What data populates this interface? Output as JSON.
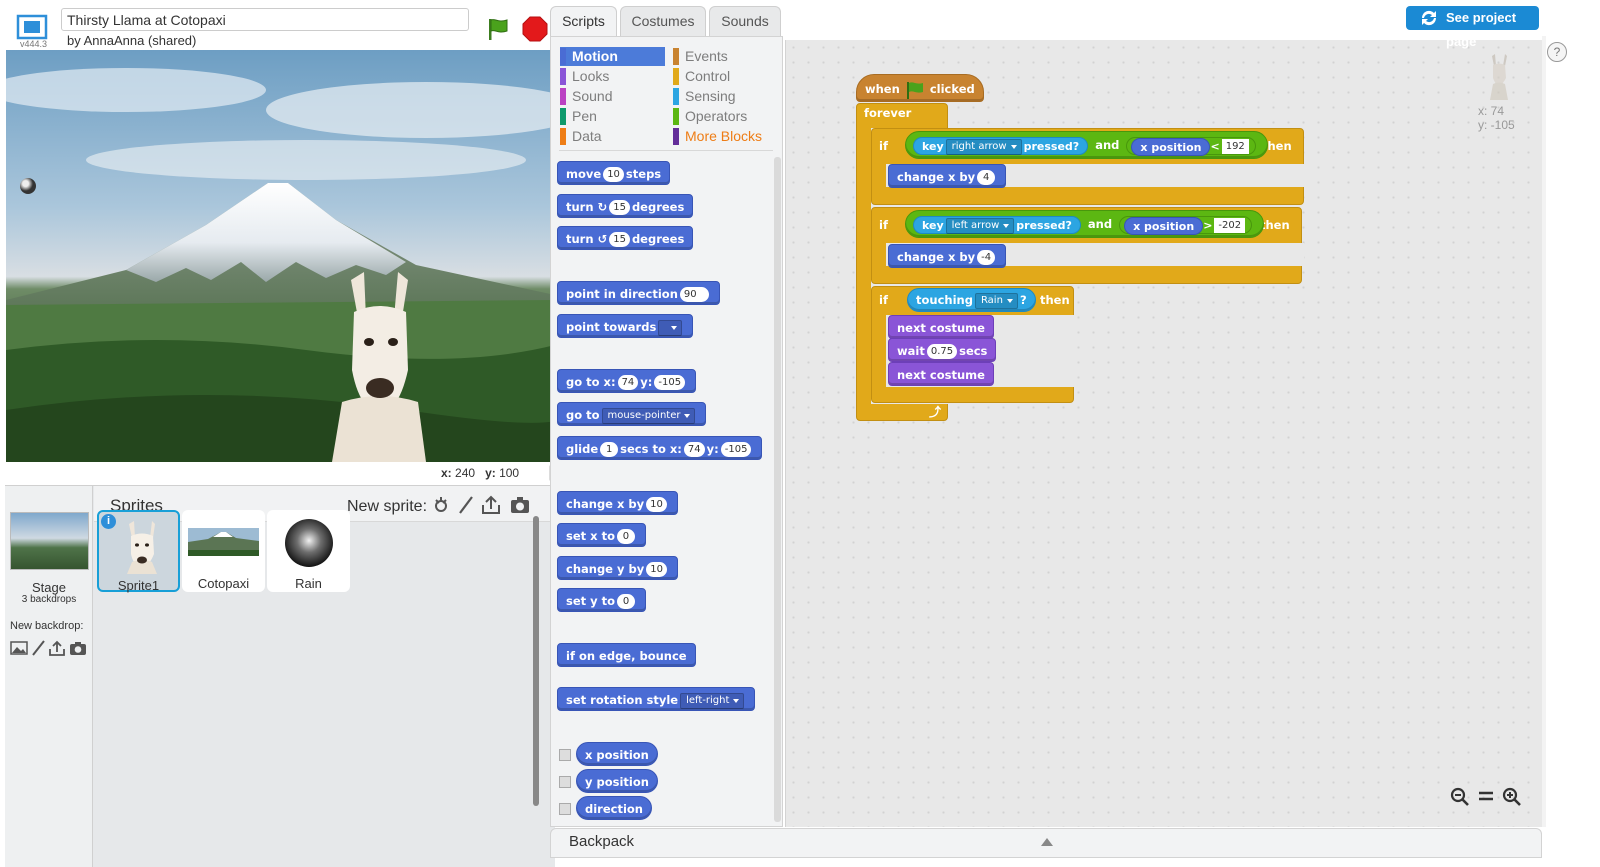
{
  "header": {
    "version": "v444.3",
    "project_title": "Thirsty Llama at Cotopaxi",
    "byline": "by AnnaAnna (shared)"
  },
  "stage": {
    "coords_x_label": "x:",
    "coords_x": "240",
    "coords_y_label": "y:",
    "coords_y": "100"
  },
  "sprites_pane": {
    "title": "Sprites",
    "new_sprite_label": "New sprite:",
    "stage_label": "Stage",
    "backdrops": "3 backdrops",
    "new_backdrop_label": "New backdrop:",
    "sprites": [
      {
        "name": "Sprite1"
      },
      {
        "name": "Cotopaxi"
      },
      {
        "name": "Rain"
      }
    ]
  },
  "tabs": [
    "Scripts",
    "Costumes",
    "Sounds"
  ],
  "categories": {
    "left": [
      "Motion",
      "Looks",
      "Sound",
      "Pen",
      "Data"
    ],
    "right": [
      "Events",
      "Control",
      "Sensing",
      "Operators",
      "More Blocks"
    ],
    "colors": {
      "Motion": "#4a6cd4",
      "Looks": "#8a55d7",
      "Sound": "#bb42c3",
      "Pen": "#0e9a6c",
      "Data": "#ee7d16",
      "Events": "#c88330",
      "Control": "#e1a91a",
      "Sensing": "#2ca5e2",
      "Operators": "#5cb712",
      "More Blocks": "#632d99"
    },
    "selected": "Motion"
  },
  "palette": {
    "move": {
      "a": "move",
      "n": "10",
      "b": "steps"
    },
    "turn_cw": {
      "a": "turn",
      "n": "15",
      "b": "degrees"
    },
    "turn_ccw": {
      "a": "turn",
      "n": "15",
      "b": "degrees"
    },
    "point_dir": {
      "a": "point in direction",
      "n": "90"
    },
    "point_towards": {
      "a": "point towards"
    },
    "goto_xy": {
      "a": "go to x:",
      "x": "74",
      "b": "y:",
      "y": "-105"
    },
    "goto": {
      "a": "go to",
      "dd": "mouse-pointer"
    },
    "glide": {
      "a": "glide",
      "n": "1",
      "b": "secs to x:",
      "x": "74",
      "c": "y:",
      "y": "-105"
    },
    "change_x": {
      "a": "change x by",
      "n": "10"
    },
    "set_x": {
      "a": "set x to",
      "n": "0"
    },
    "change_y": {
      "a": "change y by",
      "n": "10"
    },
    "set_y": {
      "a": "set y to",
      "n": "0"
    },
    "bounce": {
      "a": "if on edge, bounce"
    },
    "rotation": {
      "a": "set rotation style",
      "dd": "left-right"
    },
    "reporters": [
      "x position",
      "y position",
      "direction"
    ]
  },
  "script": {
    "hat": {
      "a": "when",
      "b": "clicked"
    },
    "forever": "forever",
    "if1": {
      "if": "if",
      "key": "key",
      "dd": "right arrow",
      "pressed": "pressed?",
      "and": "and",
      "xpos": "x position",
      "op": "<",
      "val": "192",
      "then": "then"
    },
    "change1": {
      "a": "change x by",
      "n": "4"
    },
    "if2": {
      "if": "if",
      "key": "key",
      "dd": "left arrow",
      "pressed": "pressed?",
      "and": "and",
      "xpos": "x position",
      "op": ">",
      "val": "-202",
      "then": "then"
    },
    "change2": {
      "a": "change x by",
      "n": "-4"
    },
    "if3": {
      "if": "if",
      "touching": "touching",
      "dd": "Rain",
      "q": "?",
      "then": "then"
    },
    "next1": "next costume",
    "wait": {
      "a": "wait",
      "n": "0.75",
      "b": "secs"
    },
    "next2": "next costume"
  },
  "sprite_info": {
    "x": "x: 74",
    "y": "y: -105"
  },
  "see_project": "See project page",
  "help": "?",
  "backpack": "Backpack",
  "icons": {
    "fullscreen": "fullscreen-icon",
    "flag": "green-flag-icon",
    "stop": "stop-icon",
    "zoom_out": "zoom-out-icon",
    "zoom_reset": "zoom-reset-icon",
    "zoom_in": "zoom-in-icon"
  }
}
